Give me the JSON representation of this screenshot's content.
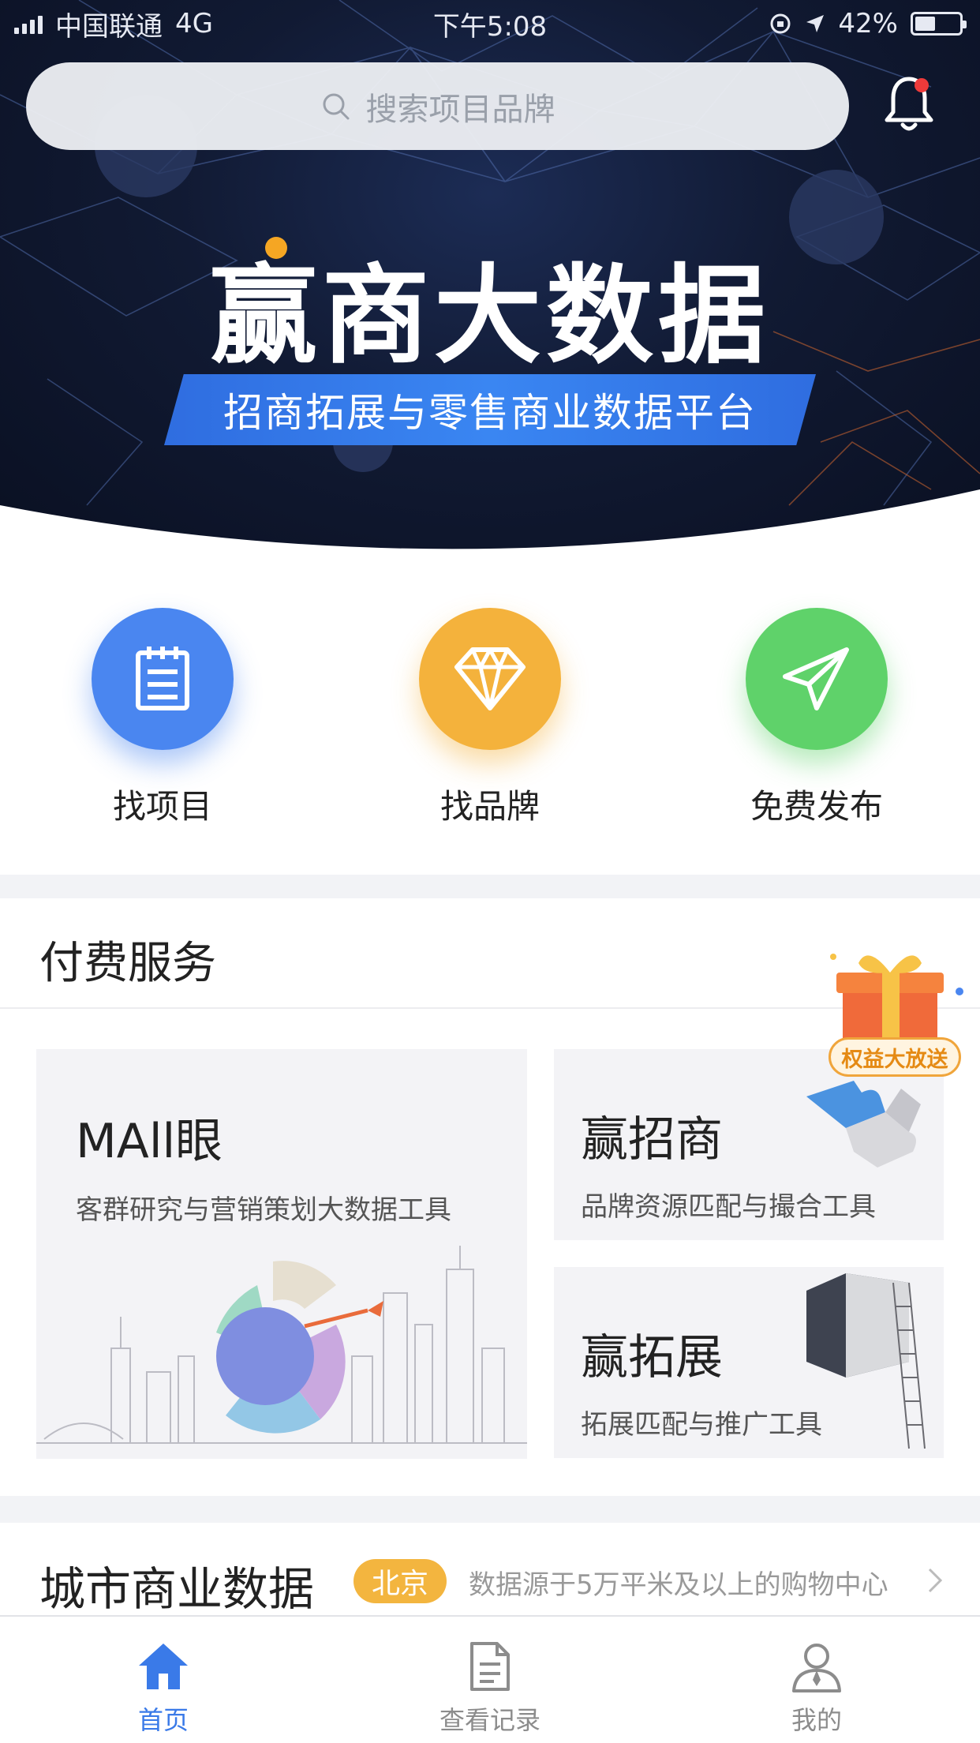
{
  "status_bar": {
    "carrier": "中国联通",
    "network": "4G",
    "time": "下午5:08",
    "battery": "42%"
  },
  "search": {
    "placeholder": "搜索项目品牌"
  },
  "banner": {
    "title": "赢商大数据",
    "subtitle": "招商拓展与零售商业数据平台"
  },
  "quick_menu": [
    {
      "label": "找项目",
      "icon": "clipboard-icon",
      "color": "#4a86f0"
    },
    {
      "label": "找品牌",
      "icon": "diamond-icon",
      "color": "#f4b23c"
    },
    {
      "label": "免费发布",
      "icon": "paper-plane-icon",
      "color": "#5fd26a"
    }
  ],
  "paid_services": {
    "title": "付费服务",
    "promo_badge": "权益大放送",
    "cards": [
      {
        "title": "MAll眼",
        "subtitle": "客群研究与营销策划大数据工具"
      },
      {
        "title": "赢招商",
        "subtitle": "品牌资源匹配与撮合工具"
      },
      {
        "title": "赢拓展",
        "subtitle": "拓展匹配与推广工具"
      }
    ]
  },
  "city_data": {
    "title": "城市商业数据",
    "city": "北京",
    "note": "数据源于5万平米及以上的购物中心"
  },
  "tab_bar": [
    {
      "label": "首页",
      "icon": "home-icon",
      "active": true
    },
    {
      "label": "查看记录",
      "icon": "document-icon",
      "active": false
    },
    {
      "label": "我的",
      "icon": "user-icon",
      "active": false
    }
  ],
  "colors": {
    "accent": "#3a7ae8",
    "hero_bg": "#111a33",
    "ribbon": "#3a86f2",
    "pill": "#f3b53f"
  }
}
